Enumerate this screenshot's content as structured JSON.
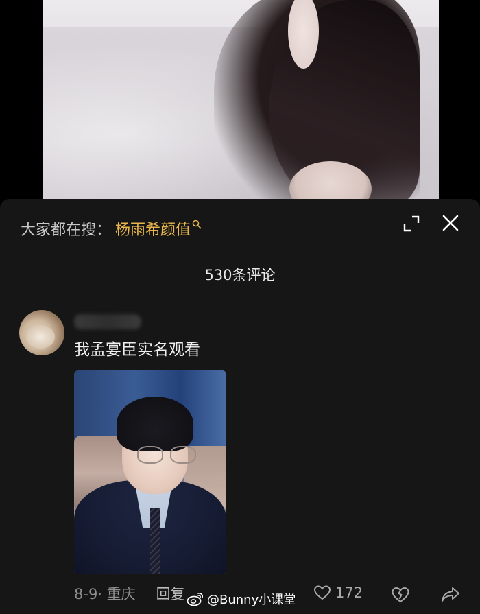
{
  "search": {
    "prefix": "大家都在搜：",
    "term": "杨雨希颜值",
    "accent_color": "#e8b64a"
  },
  "header": {
    "comment_count": "530条评论",
    "expand_icon": "expand-icon",
    "close_icon": "close-icon"
  },
  "comment": {
    "text": "我孟宴臣实名观看",
    "date_location": "8-9· 重庆",
    "reply_label": "回复",
    "like_count": "172"
  },
  "watermark": {
    "text": "@Bunny小课堂",
    "icon": "weibo-icon"
  }
}
